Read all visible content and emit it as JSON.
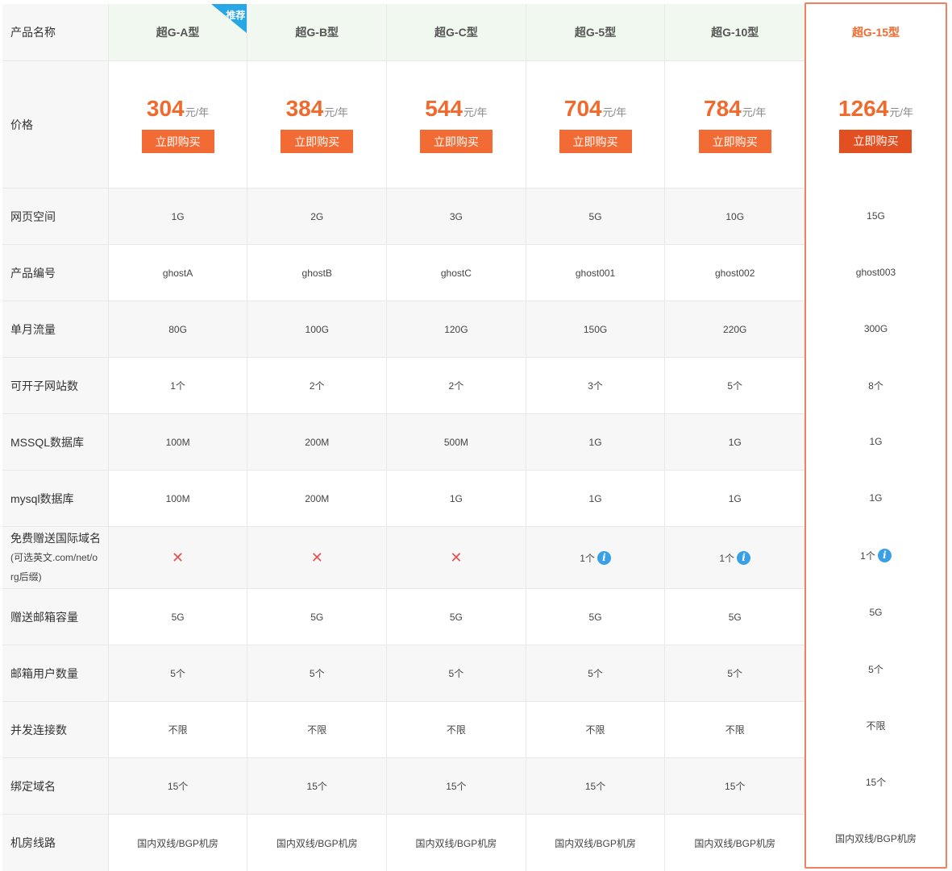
{
  "labels": {
    "name": "产品名称",
    "price": "价格",
    "space": "网页空间",
    "code": "产品编号",
    "traffic": "单月流量",
    "subsites": "可开子网站数",
    "mssql": "MSSQL数据库",
    "mysql": "mysql数据库",
    "domain_l1": "免费赠送国际域名",
    "domain_l2": "(可选英文.com/net/o",
    "domain_l3": "rg后缀)",
    "mailbox": "赠送邮箱容量",
    "mailusers": "邮箱用户数量",
    "conn": "并发连接数",
    "bind": "绑定域名",
    "line": "机房线路"
  },
  "badge": "推荐",
  "buy_label": "立即购买",
  "price_unit": "元/年",
  "colors": {
    "accent": "#f06a2e",
    "button": "#f26b34",
    "featured_button": "#e24f20",
    "info": "#3aa0e6",
    "ribbon": "#28a7e6"
  },
  "products": [
    {
      "name": "超G-A型",
      "price": "304",
      "space": "1G",
      "code": "ghostA",
      "traffic": "80G",
      "subsites": "1个",
      "mssql": "100M",
      "mysql": "100M",
      "domain": "",
      "domain_icon": "x-icon",
      "mailbox": "5G",
      "mailusers": "5个",
      "conn": "不限",
      "bind": "15个",
      "line": "国内双线/BGP机房"
    },
    {
      "name": "超G-B型",
      "price": "384",
      "space": "2G",
      "code": "ghostB",
      "traffic": "100G",
      "subsites": "2个",
      "mssql": "200M",
      "mysql": "200M",
      "domain": "",
      "domain_icon": "x-icon",
      "mailbox": "5G",
      "mailusers": "5个",
      "conn": "不限",
      "bind": "15个",
      "line": "国内双线/BGP机房"
    },
    {
      "name": "超G-C型",
      "price": "544",
      "space": "3G",
      "code": "ghostC",
      "traffic": "120G",
      "subsites": "2个",
      "mssql": "500M",
      "mysql": "1G",
      "domain": "",
      "domain_icon": "x-icon",
      "mailbox": "5G",
      "mailusers": "5个",
      "conn": "不限",
      "bind": "15个",
      "line": "国内双线/BGP机房"
    },
    {
      "name": "超G-5型",
      "price": "704",
      "space": "5G",
      "code": "ghost001",
      "traffic": "150G",
      "subsites": "3个",
      "mssql": "1G",
      "mysql": "1G",
      "domain": "1个",
      "domain_icon": "info-icon",
      "mailbox": "5G",
      "mailusers": "5个",
      "conn": "不限",
      "bind": "15个",
      "line": "国内双线/BGP机房"
    },
    {
      "name": "超G-10型",
      "price": "784",
      "space": "10G",
      "code": "ghost002",
      "traffic": "220G",
      "subsites": "5个",
      "mssql": "1G",
      "mysql": "1G",
      "domain": "1个",
      "domain_icon": "info-icon",
      "mailbox": "5G",
      "mailusers": "5个",
      "conn": "不限",
      "bind": "15个",
      "line": "国内双线/BGP机房"
    },
    {
      "name": "超G-15型",
      "price": "1264",
      "space": "15G",
      "code": "ghost003",
      "traffic": "300G",
      "subsites": "8个",
      "mssql": "1G",
      "mysql": "1G",
      "domain": "1个",
      "domain_icon": "info-icon",
      "mailbox": "5G",
      "mailusers": "5个",
      "conn": "不限",
      "bind": "15个",
      "line": "国内双线/BGP机房"
    }
  ]
}
